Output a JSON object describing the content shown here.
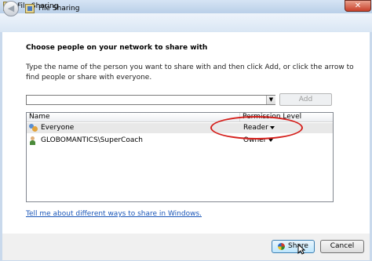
{
  "window": {
    "title": "File Sharing",
    "close_glyph": "✕",
    "title_icon": "file-sharing-icon"
  },
  "header": {
    "back_glyph": "◀",
    "title": "File Sharing",
    "title_icon": "file-sharing-icon"
  },
  "main": {
    "heading": "Choose people on your network to share with",
    "instructions": "Type the name of the person you want to share with and then click Add, or click the arrow to find people or share with everyone.",
    "name_input": {
      "value": "",
      "placeholder": ""
    },
    "dropdown_glyph": "▼",
    "add_label": "Add",
    "columns": {
      "name": "Name",
      "permission": "Permission Level"
    },
    "rows": [
      {
        "name": "Everyone",
        "permission": "Reader",
        "icon": "users-icon",
        "selected": true
      },
      {
        "name": "GLOBOMANTICS\\SuperCoach",
        "permission": "Owner",
        "icon": "user-icon",
        "selected": false
      }
    ],
    "annotation_color": "#d5201c",
    "help_link": "Tell me about different ways to share in Windows."
  },
  "footer": {
    "share_label": "Share",
    "cancel_label": "Cancel",
    "share_icon": "shield-icon"
  },
  "colors": {
    "link": "#1a56b8",
    "close_button": "#c8402a",
    "selected_row": "#e8e8e8"
  }
}
